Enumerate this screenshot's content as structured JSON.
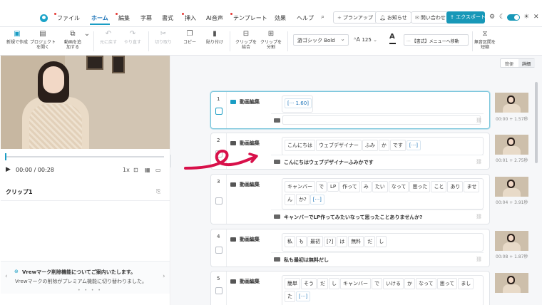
{
  "menubar": {
    "items": [
      {
        "label": "ファイル",
        "dot": true
      },
      {
        "label": "ホーム",
        "dot": false,
        "active": true
      },
      {
        "label": "編集",
        "dot": true
      },
      {
        "label": "字幕",
        "dot": false
      },
      {
        "label": "書式",
        "dot": false
      },
      {
        "label": "挿入",
        "dot": true
      },
      {
        "label": "AI音声",
        "dot": false
      },
      {
        "label": "テンプレート",
        "dot": true
      },
      {
        "label": "効果",
        "dot": false
      },
      {
        "label": "ヘルプ",
        "dot": false
      }
    ],
    "plan_up": "プランアップ",
    "notice": "お知らせ",
    "contact": "問い合わせ",
    "export": "エクスポート",
    "accent_color": "#1898b8"
  },
  "toolbar": {
    "new": "新規で作成",
    "open": "プロジェクトを開く",
    "add_video": "動画を追加する",
    "undo": "元に戻す",
    "redo": "やり直す",
    "cut": "切り取り",
    "copy": "コピー",
    "paste": "貼り付け",
    "merge": "クリップを結合",
    "split": "クリップを分割",
    "font": "游ゴシック Bold",
    "font_size": "125",
    "format_menu": "【書式】メニューへ移動",
    "silence": "無音区間を短縮"
  },
  "player": {
    "time": "00:00 / 00:28",
    "speed": "1x",
    "progress": 0.0
  },
  "clip_panel": {
    "title": "クリップ1"
  },
  "notice": {
    "title": "Vrewマーク削除機能についてご案内いたします。",
    "body": "Vrewマークの削除がプレミアム機能に切り替わりました。"
  },
  "view_tabs": {
    "simple": "簡便",
    "detail": "詳細"
  },
  "clips": [
    {
      "num": "1",
      "type": "動画編集",
      "words": [
        "[··· 1.60]"
      ],
      "subtitle": "",
      "time": "00:00 + 1.57秒"
    },
    {
      "num": "2",
      "type": "動画編集",
      "words": [
        "こんにちは",
        "ウェブデザイナー",
        "ふみ",
        "か",
        "です",
        "[···]"
      ],
      "subtitle": "こんにちはウェブデザイナーふみかです",
      "time": "00:01 + 2.75秒"
    },
    {
      "num": "3",
      "type": "動画編集",
      "words": [
        "キャンバー",
        "で",
        "LP",
        "作って",
        "み",
        "たい",
        "なって",
        "思った",
        "こと",
        "あり",
        "ませ",
        "ん",
        "か?",
        "[···]"
      ],
      "subtitle": "キャンバーでLP作ってみたいなって思ったことありませんか?",
      "time": "00:04 + 3.91秒"
    },
    {
      "num": "4",
      "type": "動画編集",
      "words": [
        "私",
        "も",
        "最初",
        "[?]",
        "は",
        "無料",
        "だ",
        "し"
      ],
      "subtitle": "私も最初は無料だし",
      "time": "00:08 + 1.87秒"
    },
    {
      "num": "5",
      "type": "動画編集",
      "words": [
        "簡単",
        "そう",
        "だ",
        "し",
        "キャンバー",
        "で",
        "いける",
        "か",
        "なって",
        "思って",
        "まし",
        "た",
        "[···]"
      ],
      "subtitle": "",
      "time": ""
    }
  ]
}
